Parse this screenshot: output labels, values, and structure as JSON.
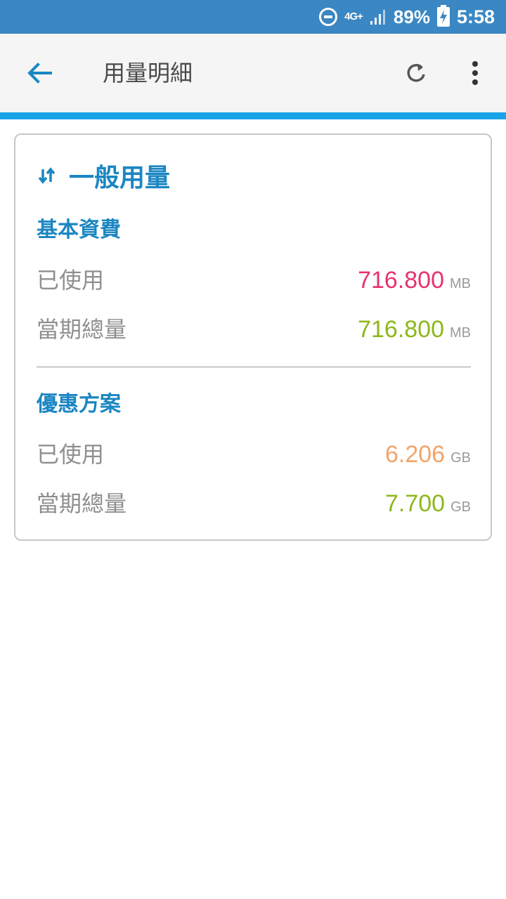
{
  "status_bar": {
    "network": "4G+",
    "battery_percent": "89%",
    "time": "5:58",
    "icons": [
      "do-not-disturb-icon",
      "network-4g-icon",
      "signal-icon",
      "battery-charging-icon"
    ]
  },
  "toolbar": {
    "title": "用量明細",
    "back_icon": "arrow-back-icon",
    "refresh_icon": "refresh-icon",
    "more_icon": "more-vert-icon"
  },
  "card": {
    "title": "一般用量",
    "icon": "data-transfer-icon",
    "sections": [
      {
        "title": "基本資費",
        "rows": [
          {
            "label": "已使用",
            "value": "716.800",
            "unit": "MB",
            "color": "#e8336d"
          },
          {
            "label": "當期總量",
            "value": "716.800",
            "unit": "MB",
            "color": "#8db81a"
          }
        ]
      },
      {
        "title": "優惠方案",
        "rows": [
          {
            "label": "已使用",
            "value": "6.206",
            "unit": "GB",
            "color": "#f2a46b"
          },
          {
            "label": "當期總量",
            "value": "7.700",
            "unit": "GB",
            "color": "#8db81a"
          }
        ]
      }
    ]
  },
  "colors": {
    "status_bar": "#3a87c3",
    "accent": "#1aa3e8",
    "section_title": "#1b86c2"
  }
}
